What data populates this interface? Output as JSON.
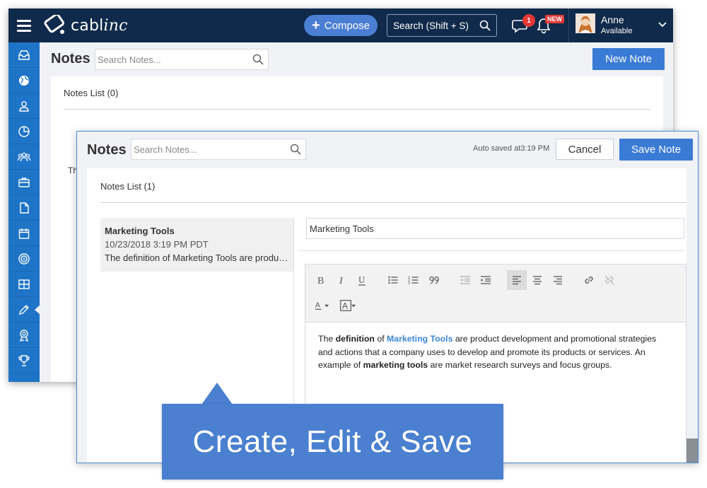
{
  "brand": {
    "logo_text_a": "cabl",
    "logo_text_b": "inc"
  },
  "topbar": {
    "compose_label": "Compose",
    "search_label": "Search (Shift + S)",
    "chat_badge_count": "1",
    "notification_badge": "NEW",
    "user_name": "Anne",
    "user_status": "Available"
  },
  "sidebar": {
    "items": [
      {
        "icon": "inbox-icon"
      },
      {
        "icon": "globe-icon"
      },
      {
        "icon": "user-icon"
      },
      {
        "icon": "pie-chart-icon"
      },
      {
        "icon": "group-icon"
      },
      {
        "icon": "briefcase-icon"
      },
      {
        "icon": "document-icon"
      },
      {
        "icon": "calendar-icon"
      },
      {
        "icon": "target-icon"
      },
      {
        "icon": "table-icon"
      },
      {
        "icon": "pencil-icon",
        "active": true
      },
      {
        "icon": "award-icon"
      },
      {
        "icon": "trophy-icon"
      }
    ]
  },
  "background_window": {
    "title": "Notes",
    "search_placeholder": "Search Notes...",
    "new_note_label": "New Note",
    "list_title": "Notes List",
    "list_count": "(0)",
    "peek_text": "Th"
  },
  "foreground_window": {
    "title": "Notes",
    "search_placeholder": "Search Notes...",
    "autosave_text": "Auto saved at3:19 PM",
    "cancel_label": "Cancel",
    "save_label": "Save Note",
    "list_title": "Notes List",
    "list_count": "(1)",
    "notes": [
      {
        "title": "Marketing Tools",
        "date": "10/23/2018 3:19 PM PDT",
        "snippet": "The definition of Marketing Tools are product development and promotional strategies"
      }
    ],
    "editor": {
      "title_value": "Marketing Tools",
      "body": {
        "p1": "The ",
        "b1": "definition",
        "p2": " of ",
        "hl": "Marketing Tools",
        "p3": " are product development and promotional strategies and actions that a company uses to develop and promote its products or services. An example of ",
        "b2": "marketing tools",
        "p4": " are market research surveys and focus groups."
      },
      "toolbar": [
        "bold-icon",
        "italic-icon",
        "underline-icon",
        "bullet-list-icon",
        "numbered-list-icon",
        "quote-icon",
        "outdent-icon",
        "indent-icon",
        "align-left-icon",
        "align-center-icon",
        "align-right-icon",
        "link-icon",
        "unlink-icon",
        "font-color-icon",
        "highlight-color-icon"
      ]
    }
  },
  "callout": {
    "text": "Create, Edit & Save"
  },
  "colors": {
    "topbar": "#0f2a4a",
    "sidebar": "#1e74c6",
    "primary_button": "#3a7bd5",
    "callout": "#4a80cf",
    "badge": "#e53935",
    "link_highlight": "#3a86d8"
  }
}
